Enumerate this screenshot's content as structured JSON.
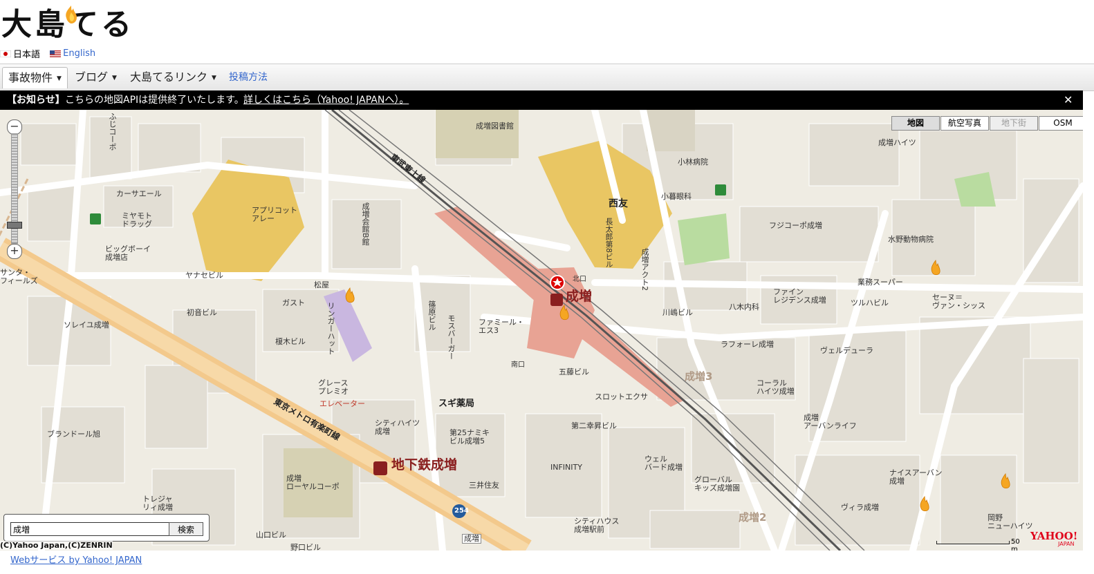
{
  "site": {
    "logo_text": "大島てる"
  },
  "lang": {
    "ja": "日本語",
    "en": "English"
  },
  "nav": {
    "jiko": "事故物件",
    "blog": "ブログ",
    "links": "大島てるリンク",
    "post": "投稿方法"
  },
  "notice": {
    "label": "【お知らせ】",
    "text": "こちらの地図APIは提供終了いたします。",
    "link": "詳しくはこちら（Yahoo! JAPANへ）。",
    "close": "✕"
  },
  "map_types": {
    "map": "地図",
    "aerial": "航空写真",
    "underground": "地下街",
    "osm": "OSM"
  },
  "zoom": {
    "minus": "−",
    "plus": "+"
  },
  "search": {
    "value": "成増",
    "button": "検索"
  },
  "copyright": "(C)Yahoo Japan,(C)ZENRIN",
  "scale": "50 m",
  "yahoo": {
    "logo": "YAHOO!",
    "sub": "JAPAN"
  },
  "footer": "Webサービス by Yahoo! JAPAN",
  "map_labels": {
    "station_main": "成増",
    "station_sub": "地下鉄成増",
    "north_exit": "北口",
    "south_exit": "南口",
    "line_tobu": "東武東上線",
    "line_metro": "東京メトロ有楽町線",
    "seiyu": "西友",
    "library": "成増図書館",
    "applicot": "アプリコット\nアレー",
    "carsale": "カーサエール",
    "miyamoto": "ミヤモト\nドラッグ",
    "bigboy": "ビッグボーイ\n成増店",
    "santa": "サンタ・\nフィールズ",
    "yanase": "ヤナセビル",
    "kobayashi": "小林病院",
    "kogure": "小暮眼科",
    "fujicorpo": "フジコーポ成増",
    "mizuno": "水野動物病院",
    "gyomu": "業務スーパー",
    "tsuruha": "ツルハビル",
    "sevena": "セーヌ＝\nヴァン・シッス",
    "kawashima": "川嶋ビル",
    "yagi": "八木内科",
    "finelegi": "ファイン\nレジデンス成増",
    "laforet": "ラフォーレ成増",
    "verdure": "ヴェルデューラ",
    "coral": "コーラル\nハイツ成増",
    "urban": "成増\nアーバンライフ",
    "family": "ファミール・\nエス3",
    "gokura": "五藤ビル",
    "slot": "スロットエクサ",
    "daini": "第二幸昇ビル",
    "sugi": "スギ薬局",
    "namiki": "第25ナミキ\nビル成増5",
    "mitsui": "三井住友",
    "infinity": "INFINITY",
    "wel": "ウェル\nバード成増",
    "global": "グローバル\nキッズ成増園",
    "cityhouse": "シティハウス\n成増駅前",
    "villa": "ヴィラ成増",
    "nice": "ナイスアーバン\n成増",
    "okano": "岡野\nニューハイツ",
    "naruhmasu3": "成増3",
    "naruhmasu2": "成増2",
    "matsuya": "松屋",
    "hatsune": "初音ビル",
    "gust": "ガスト",
    "solei": "ソレイユ成増",
    "enoki": "榎木ビル",
    "grace": "グレース\nプレミオ",
    "elevator": "エレベーター",
    "cityheights": "シティハイツ\n成増",
    "brandor": "ブランドール旭",
    "royal": "成増\nローヤルコーポ",
    "treasure": "トレジャ\nリィ成増",
    "yamaguchi": "山口ビル",
    "noguchi": "野口ビル",
    "naruhmasu_sign": "成増",
    "ringer": "リンガーハット",
    "mos": "モスバーガー",
    "shinohara": "篠原ビル",
    "kaikan": "成増会館B館",
    "fujicorpo2": "ふじコーポ",
    "naruhmasu_heights": "成増ハイツ",
    "chotaro": "長太郎第8ビル",
    "act2": "成増アクト2",
    "route254": "254"
  }
}
